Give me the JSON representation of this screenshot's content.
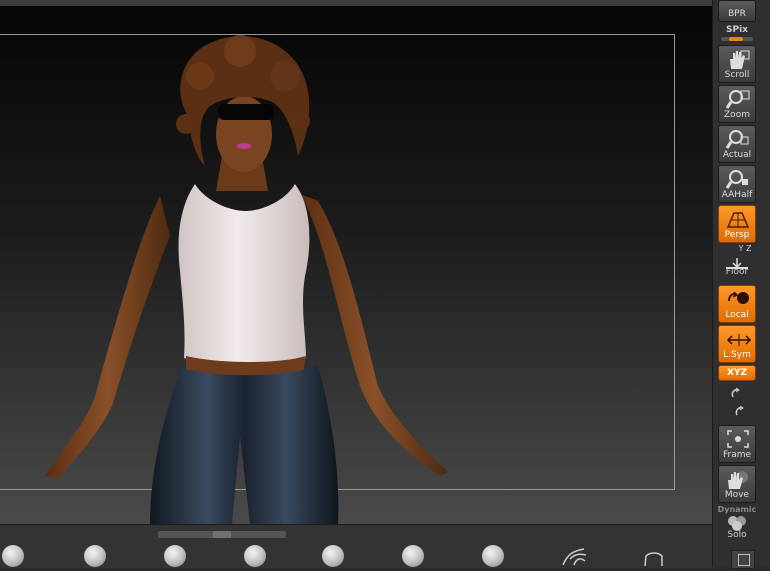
{
  "toolbar": {
    "bpr_label": "BPR",
    "spix_label": "SPix",
    "scroll_label": "Scroll",
    "zoom_label": "Zoom",
    "actual_label": "Actual",
    "aahalf_label": "AAHalf",
    "persp_label": "Persp",
    "floor_small": "Y Z",
    "floor_label": "Floor",
    "local_label": "Local",
    "lsym_label": "L.Sym",
    "xyz_label": "XYZ",
    "frame_label": "Frame",
    "move_label": "Move",
    "dynamic_label": "Dynamic",
    "solo_label": "Solo"
  },
  "states": {
    "persp_active": true,
    "local_active": true,
    "lsym_active": true,
    "xyz_active": true
  },
  "colors": {
    "accent_orange": "#f0830e",
    "toolbar_bg": "#2f2f2f",
    "viewport_top": "#050505",
    "viewport_bottom": "#4a4a4a",
    "shirt": "#e8dede",
    "skin": "#7a4420",
    "pants": "#1c2533",
    "hair": "#5a2f14"
  },
  "brush_tray": {
    "icons": [
      "sphere-brush-icon",
      "sphere-brush-icon",
      "sphere-brush-icon",
      "sphere-brush-icon",
      "sphere-brush-icon",
      "sphere-brush-icon",
      "sphere-brush-icon",
      "curl-brush-icon",
      "outline-brush-icon"
    ]
  }
}
